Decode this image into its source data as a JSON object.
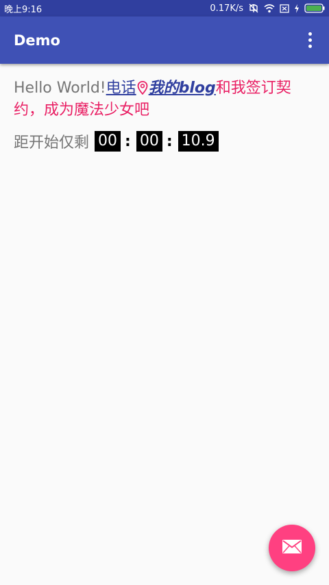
{
  "status_bar": {
    "time": "晚上9:16",
    "network_speed": "0.17K/s",
    "icons": [
      "mute-icon",
      "wifi-icon",
      "sim-icon",
      "charging-icon",
      "battery-icon"
    ]
  },
  "app_bar": {
    "title": "Demo",
    "menu_icon": "more-vert-icon"
  },
  "content": {
    "hello": "Hello World!",
    "phone_link": "电话",
    "location_icon": "location-pin-icon",
    "blog_link": "我的blog",
    "pink_text": "和我签订契约，成为魔法少女吧",
    "countdown_label": "距开始仅剩",
    "hours": "00",
    "separator_1": ":",
    "minutes": "00",
    "separator_2": ":",
    "seconds": "10.9"
  },
  "fab": {
    "icon": "mail-icon"
  },
  "colors": {
    "status_bar": "#303f9f",
    "app_bar": "#3f51b5",
    "accent": "#ff4081",
    "pink_text": "#e91e63",
    "link": "#303f9f",
    "body_text": "#757575"
  }
}
